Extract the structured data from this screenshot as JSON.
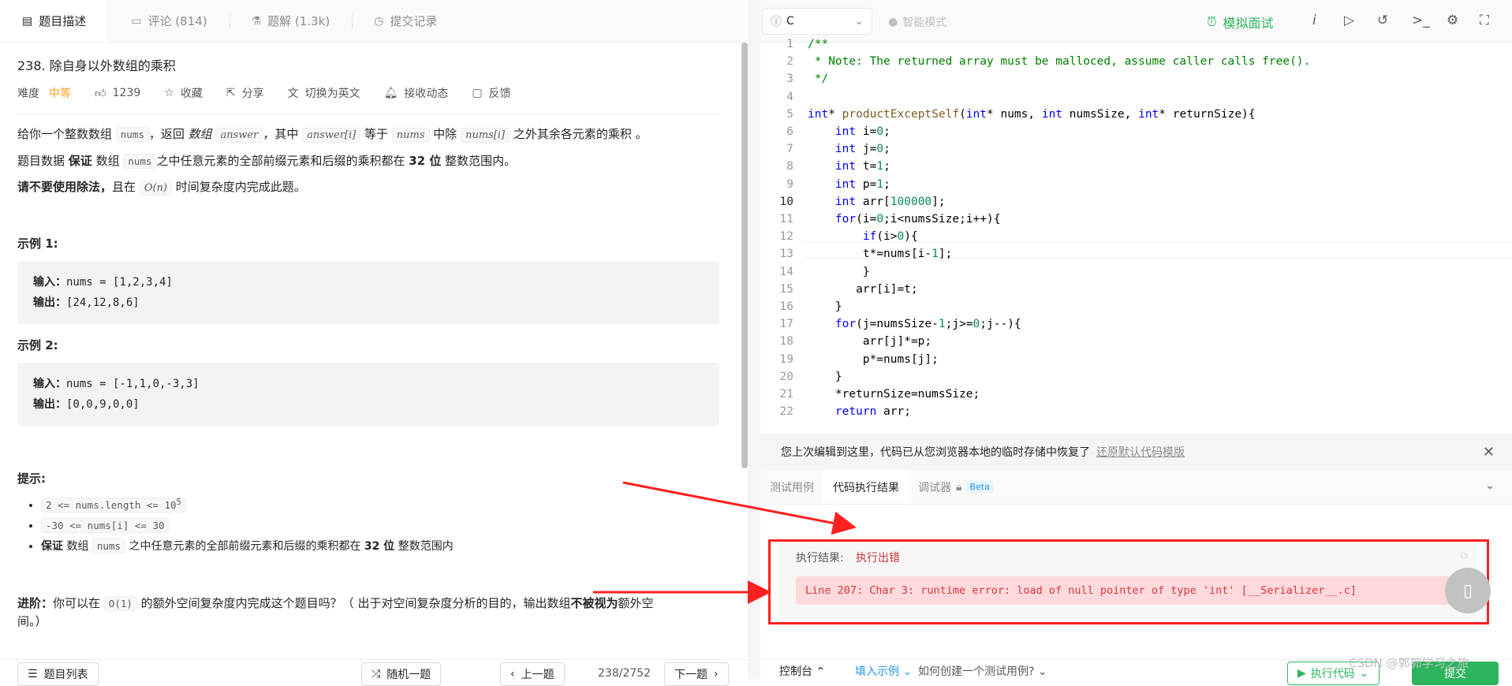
{
  "left": {
    "tabs": [
      {
        "label": "题目描述",
        "icon": "description-icon"
      },
      {
        "label": "评论 (814)",
        "icon": "comment-icon"
      },
      {
        "label": "题解 (1.3k)",
        "icon": "flask-icon"
      },
      {
        "label": "提交记录",
        "icon": "clock-icon"
      }
    ],
    "problem": {
      "title": "238. 除自身以外数组的乘积",
      "difficulty_label": "难度",
      "difficulty": "中等",
      "likes": "1239",
      "favorite": "收藏",
      "share": "分享",
      "translate": "切换为英文",
      "subscribe": "接收动态",
      "feedback": "反馈"
    },
    "desc": {
      "p1_a": "给你一个整数数组 ",
      "p1_nums": "nums",
      "p1_b": "，返回 ",
      "p1_c": "数组",
      "p1_answer": "answer",
      "p1_d": "，其中 ",
      "p1_answeri": "answer[i]",
      "p1_e": " 等于 ",
      "p1_nums2": "nums",
      "p1_f": " 中除 ",
      "p1_numsi": "nums[i]",
      "p1_g": " 之外其余各元素的乘积 。",
      "p2_a": "题目数据 ",
      "p2_b": "保证",
      "p2_c": " 数组 ",
      "p2_nums": "nums",
      "p2_d": "之中任意元素的全部前缀元素和后缀的乘积都在  ",
      "p2_e": "32 位",
      "p2_f": " 整数范围内。",
      "p3_a": "请",
      "p3_b": "不要使用除法，",
      "p3_c": "且在 ",
      "p3_on": "O(n)",
      "p3_d": " 时间复杂度内完成此题。"
    },
    "ex1": {
      "title": "示例 1:",
      "in_label": "输入：",
      "in": "nums = [1,2,3,4]",
      "out_label": "输出：",
      "out": "[24,12,8,6]"
    },
    "ex2": {
      "title": "示例 2:",
      "in_label": "输入：",
      "in": "nums = [-1,1,0,-3,3]",
      "out_label": "输出：",
      "out": "[0,0,9,0,0]"
    },
    "hints": {
      "title": "提示:",
      "h1": "2 <= nums.length <= 10",
      "h1_sup": "5",
      "h2": "-30 <= nums[i] <= 30",
      "h3_a": "保证",
      "h3_b": " 数组 ",
      "h3_nums": "nums",
      "h3_c": " 之中任意元素的全部前缀元素和后缀的乘积都在  ",
      "h3_d": "32 位",
      "h3_e": " 整数范围内"
    },
    "advance": {
      "label": "进阶：",
      "a": "你可以在 ",
      "o1": "O(1)",
      "b": " 的额外空间复杂度内完成这个题目吗？（ 出于对空间复杂度分析的目的，输出数组",
      "c": "不被视为",
      "d": "额外空",
      "e": "间。）"
    },
    "footer": {
      "list": "题目列表",
      "random": "随机一题",
      "prev": "上一题",
      "page": "238/2752",
      "next": "下一题"
    }
  },
  "right": {
    "language": "C",
    "smart_mode": "智能模式",
    "mock": "模拟面试",
    "code_lines": [
      "/**",
      " * Note: The returned array must be malloced, assume caller calls free().",
      " */",
      "",
      "int* productExceptSelf(int* nums, int numsSize, int* returnSize){",
      "    int i=0;",
      "    int j=0;",
      "    int t=1;",
      "    int p=1;",
      "    int arr[100000];",
      "    for(i=0;i<numsSize;i++){",
      "        if(i>0){",
      "        t*=nums[i-1];",
      "        }",
      "       arr[i]=t;",
      "    }",
      "    for(j=numsSize-1;j>=0;j--){",
      "        arr[j]*=p;",
      "        p*=nums[j];",
      "    }",
      "    *returnSize=numsSize;",
      "    return arr;"
    ],
    "notice": "您上次编辑到这里，代码已从您浏览器本地的临时存储中恢复了",
    "notice_link": "还原默认代码模版",
    "tabs": [
      "测试用例",
      "代码执行结果",
      "调试器"
    ],
    "beta": "Beta",
    "result_label": "执行结果:",
    "result_status": "执行出错",
    "error": "Line 207: Char 3: runtime error: load of null pointer of type 'int' [__Serializer__.c]",
    "footer": {
      "console": "控制台",
      "fill": "填入示例",
      "howto": "如何创建一个测试用例?",
      "run": "执行代码",
      "submit": "提交"
    },
    "watermark": "CSDN @郭郭学习之旅"
  },
  "colors": {
    "accent_green": "#2db55d",
    "error_red": "#d9363e",
    "annotation_red": "#ff2020",
    "difficulty_orange": "#ff9f1a"
  }
}
